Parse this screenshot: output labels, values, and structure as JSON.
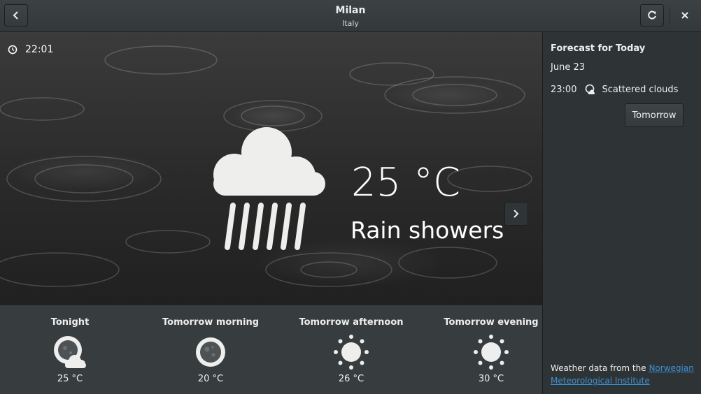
{
  "header": {
    "title": "Milan",
    "subtitle": "Italy"
  },
  "current": {
    "time": "22:01",
    "temperature": "25 °C",
    "condition": "Rain showers"
  },
  "forecast_strip": [
    {
      "label": "Tonight",
      "temp": "25 °C",
      "icon": "night-partly-cloudy-icon"
    },
    {
      "label": "Tomorrow morning",
      "temp": "20 °C",
      "icon": "clear-night-icon"
    },
    {
      "label": "Tomorrow afternoon",
      "temp": "26 °C",
      "icon": "sun-icon"
    },
    {
      "label": "Tomorrow evening",
      "temp": "30 °C",
      "icon": "sun-icon"
    }
  ],
  "sidebar": {
    "title": "Forecast for Today",
    "date": "June 23",
    "row": {
      "time": "23:00",
      "condition": "Scattered clouds",
      "icon": "scattered-clouds-icon"
    },
    "tomorrow_button": "Tomorrow",
    "attribution_prefix": "Weather data from the",
    "attribution_link": "Norwegian Meteorological Institute"
  },
  "colors": {
    "link": "#3f8fd6",
    "panel": "#2e3436",
    "strip": "#373d3f"
  }
}
